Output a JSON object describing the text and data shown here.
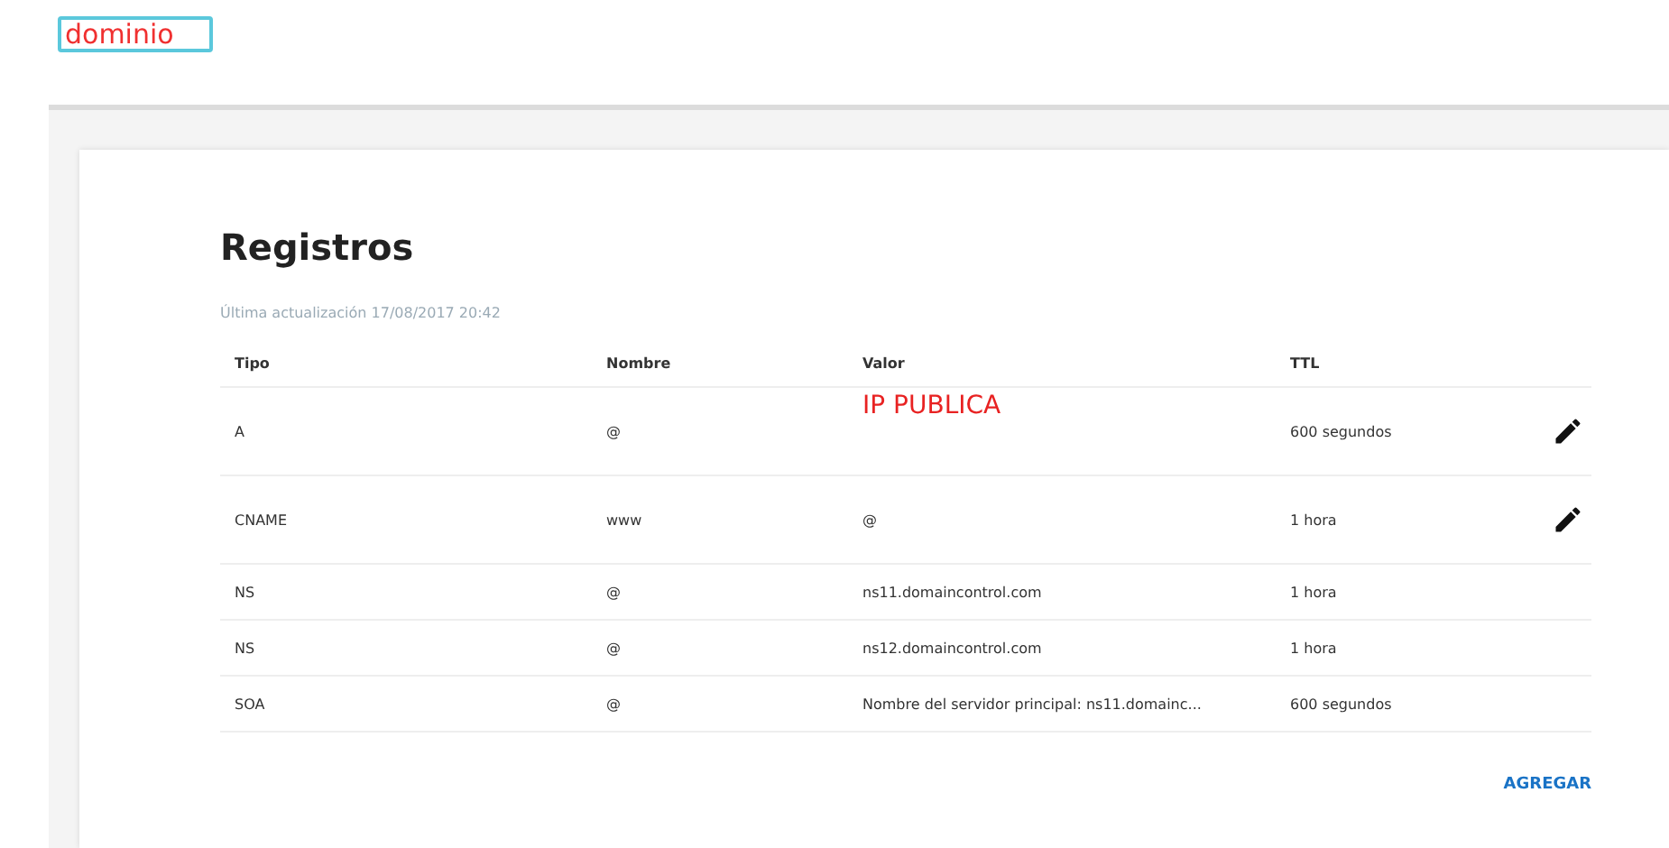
{
  "annotations": {
    "domain_label": "dominio",
    "ip_label": "IP PUBLICA"
  },
  "card": {
    "title": "Registros",
    "updated": "Última actualización 17/08/2017 20:42",
    "table": {
      "columns": [
        "Tipo",
        "Nombre",
        "Valor",
        "TTL"
      ],
      "rows": [
        {
          "tipo": "A",
          "nombre": "@",
          "ttl": "600 segundos",
          "editable": true
        },
        {
          "tipo": "CNAME",
          "nombre": "www",
          "valor": "@",
          "ttl": "1 hora",
          "editable": true
        },
        {
          "tipo": "NS",
          "nombre": "@",
          "valor": "ns11.domaincontrol.com",
          "ttl": "1 hora",
          "editable": false
        },
        {
          "tipo": "NS",
          "nombre": "@",
          "valor": "ns12.domaincontrol.com",
          "ttl": "1 hora",
          "editable": false
        },
        {
          "tipo": "SOA",
          "nombre": "@",
          "valor": "Nombre del servidor principal: ns11.domainc...",
          "ttl": "600 segundos",
          "editable": false
        }
      ]
    },
    "add_button": "AGREGAR"
  }
}
